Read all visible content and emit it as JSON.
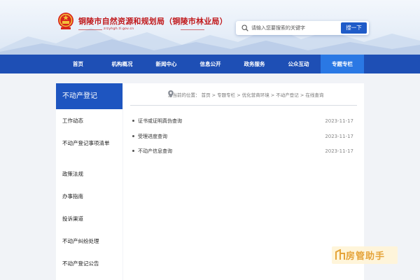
{
  "header": {
    "title": "铜陵市自然资源和规划局（铜陵市林业局）",
    "subtitle": "zrzyhgh.tl.gov.cn"
  },
  "search": {
    "placeholder": "请输入您要搜索的关键字",
    "button_label": "搜一下"
  },
  "nav": {
    "items": [
      {
        "label": "首页"
      },
      {
        "label": "机构概况"
      },
      {
        "label": "新闻中心"
      },
      {
        "label": "信息公开"
      },
      {
        "label": "政务服务"
      },
      {
        "label": "公众互动"
      },
      {
        "label": "专题专栏"
      }
    ],
    "active_index": 6
  },
  "sidebar": {
    "title": "不动产登记",
    "items": [
      {
        "label": "工作动态"
      },
      {
        "label": "不动产登记事项清单"
      },
      {
        "label": "政策法规"
      },
      {
        "label": "办事指南"
      },
      {
        "label": "投诉渠道"
      },
      {
        "label": "不动产纠纷处理"
      },
      {
        "label": "不动产登记公告"
      }
    ]
  },
  "breadcrumb": {
    "text": "您当前的位置： 首页 > 专题专栏 > 优化营商环境 > 不动产登记 > 在线查询"
  },
  "list": {
    "items": [
      {
        "title": "证书或证明真伪查询",
        "date": "2023-11-17"
      },
      {
        "title": "受理进度查询",
        "date": "2023-11-17"
      },
      {
        "title": "不动产信息查询",
        "date": "2023-11-17"
      }
    ]
  },
  "watermark": {
    "text": "房管助手"
  },
  "colors": {
    "nav_bg": "#1e4fb5",
    "nav_active": "#2a78e4",
    "title_red": "#c0181b",
    "sidebar_head": "#1e55c0"
  }
}
